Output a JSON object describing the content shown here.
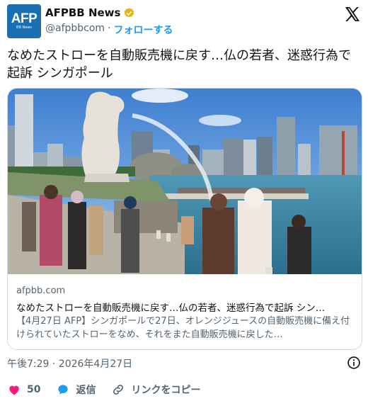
{
  "account": {
    "avatar_big": "AFP",
    "avatar_small": "BB News",
    "display_name": "AFPBB News",
    "handle": "@afpbbcom",
    "separator": "·",
    "follow_label": "フォローする",
    "verified_color": "#e2b719"
  },
  "tweet": {
    "text": "なめたストローを自動販売機に戻す…仏の若者、迷惑行為で起訴 シンガポール"
  },
  "card": {
    "domain": "afpbb.com",
    "title": "なめたストローを自動販売機に戻す…仏の若者、迷惑行為で起訴 シン…",
    "description": "【4月27日 AFP】シンガポールで27日、オレンジジュースの自動販売機に備え付けられていたストローをなめ、それをまた自動販売機に戻した…"
  },
  "meta": {
    "timestamp": "午後7:29 · 2026年4月27日"
  },
  "actions": {
    "like_count": "50",
    "reply_label": "返信",
    "copy_link_label": "リンクをコピー",
    "like_color": "#f91880",
    "reply_color": "#1d9bf0"
  },
  "icons": [
    "x-logo-icon",
    "verified-badge-icon",
    "info-icon",
    "heart-icon",
    "reply-bubble-icon",
    "link-icon"
  ]
}
